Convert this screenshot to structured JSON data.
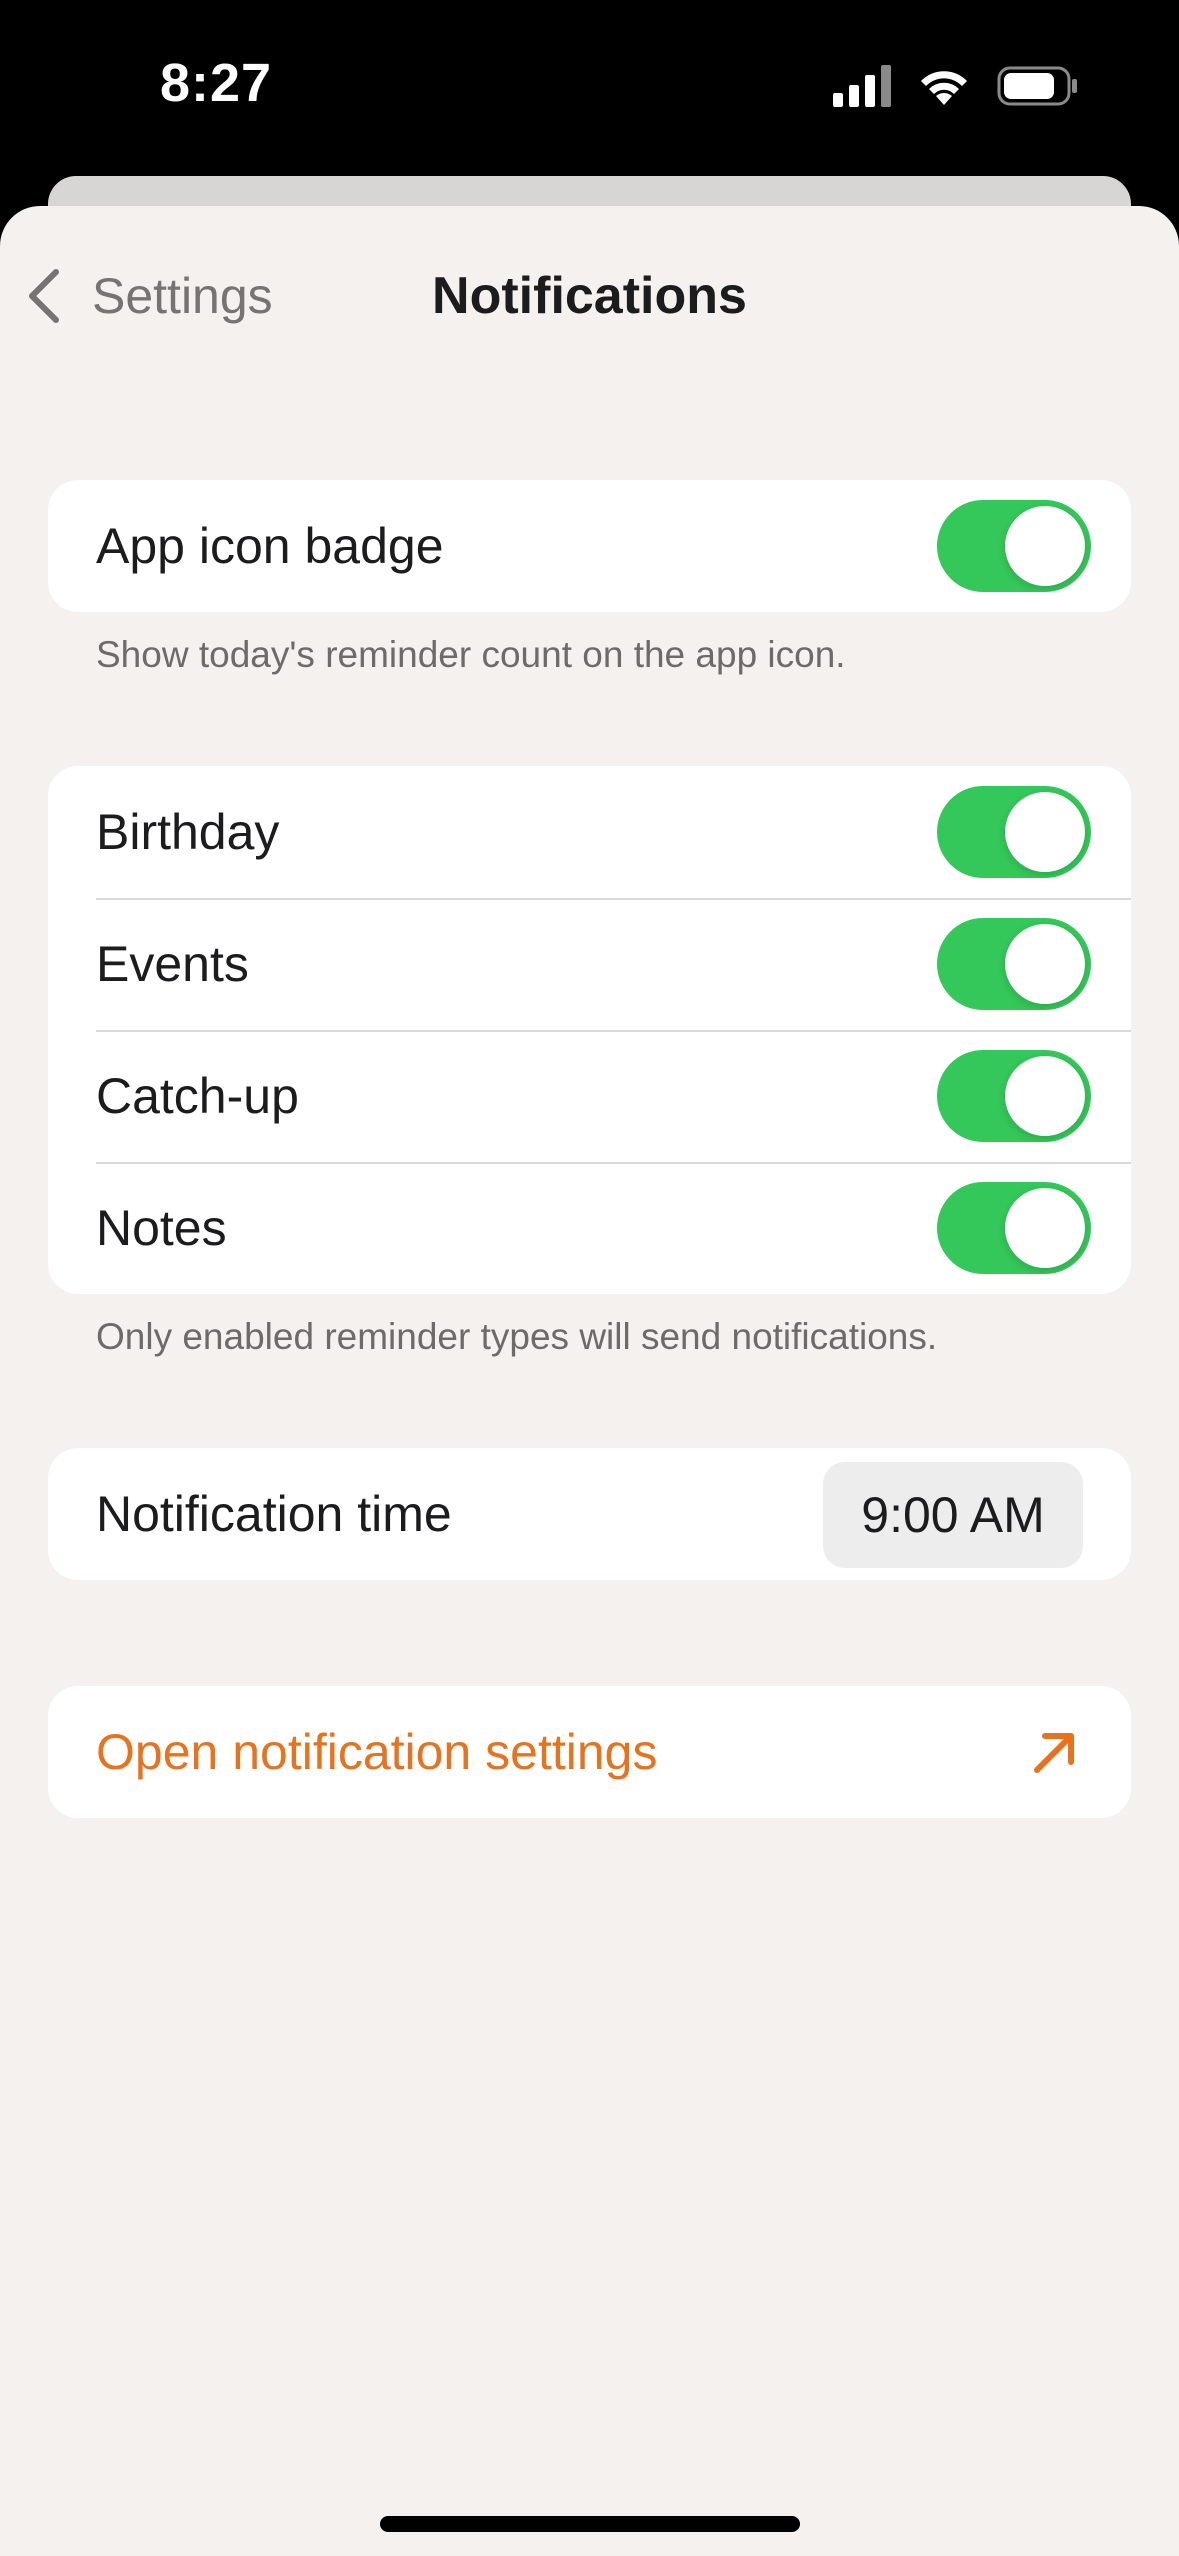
{
  "status_bar": {
    "time": "8:27"
  },
  "nav": {
    "back_label": "Settings",
    "title": "Notifications"
  },
  "badge_group": {
    "label": "App icon badge",
    "enabled": true,
    "footnote": "Show today's reminder count on the app icon."
  },
  "reminder_types": {
    "items": [
      {
        "label": "Birthday",
        "enabled": true
      },
      {
        "label": "Events",
        "enabled": true
      },
      {
        "label": "Catch-up",
        "enabled": true
      },
      {
        "label": "Notes",
        "enabled": true
      }
    ],
    "footnote": "Only enabled reminder types will send notifications."
  },
  "notification_time": {
    "label": "Notification time",
    "value": "9:00 AM"
  },
  "open_settings": {
    "label": "Open notification settings"
  },
  "colors": {
    "toggle_on": "#34c759",
    "accent": "#e8731f",
    "background": "#f4f1ef"
  },
  "icons": {
    "back": "chevron-left-icon",
    "external": "arrow-up-right-icon"
  }
}
